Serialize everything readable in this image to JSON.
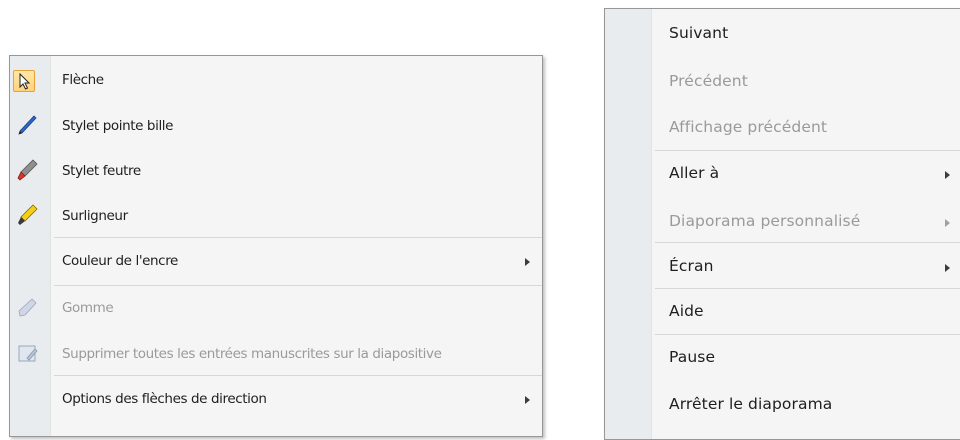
{
  "pen_menu": {
    "items": [
      {
        "label": "Flèche",
        "enabled": true,
        "selected": true,
        "icon": "arrow-pointer-icon"
      },
      {
        "label": "Stylet pointe bille",
        "enabled": true,
        "icon": "ballpoint-pen-icon"
      },
      {
        "label": "Stylet feutre",
        "enabled": true,
        "icon": "felt-tip-pen-icon"
      },
      {
        "label": "Surligneur",
        "enabled": true,
        "icon": "highlighter-icon"
      },
      {
        "label": "Couleur de l'encre",
        "enabled": true,
        "submenu": true
      },
      {
        "label": "Gomme",
        "enabled": false,
        "icon": "eraser-icon"
      },
      {
        "label": "Supprimer toutes les entrées manuscrites sur la diapositive",
        "enabled": false,
        "icon": "erase-all-ink-icon"
      },
      {
        "label": "Options des flèches de direction",
        "enabled": true,
        "submenu": true
      }
    ]
  },
  "slideshow_menu": {
    "items": [
      {
        "label": "Suivant",
        "enabled": true
      },
      {
        "label": "Précédent",
        "enabled": false
      },
      {
        "label": "Affichage précédent",
        "enabled": false
      },
      {
        "label": "Aller à",
        "enabled": true,
        "submenu": true
      },
      {
        "label": "Diaporama personnalisé",
        "enabled": false,
        "submenu": true
      },
      {
        "label": "Écran",
        "enabled": true,
        "submenu": true
      },
      {
        "label": "Aide",
        "enabled": true
      },
      {
        "label": "Pause",
        "enabled": true
      },
      {
        "label": "Arrêter le diaporama",
        "enabled": true
      }
    ]
  },
  "colors": {
    "text": "#1e1e1e",
    "disabled_text": "#9a9a9a",
    "menu_background": "#f5f5f5",
    "gutter": "#e9ecee",
    "selection_highlight": "#ffd27a"
  }
}
